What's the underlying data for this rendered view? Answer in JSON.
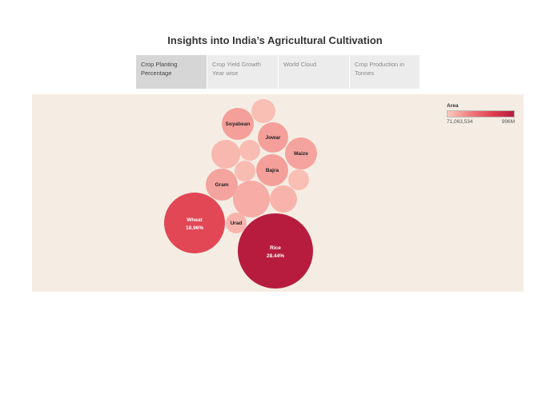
{
  "page": {
    "title": "Insights into India’s Agricultural Cultivation"
  },
  "tabs": [
    {
      "label": "Crop Planting\nPercentage",
      "active": true
    },
    {
      "label": "Crop Yield Growth\nYear wise",
      "active": false
    },
    {
      "label": "World Cloud",
      "active": false
    },
    {
      "label": "Crop Production in\nTonnes",
      "active": false
    }
  ],
  "legend": {
    "title": "Area",
    "min_label": "71,063,534",
    "max_label": "996M"
  },
  "bubbles": [
    {
      "name": "Rice",
      "pct": "28.44%",
      "label": "Rice",
      "pct_label": "28.44%",
      "level": 1.0
    },
    {
      "name": "Wheat",
      "pct": "18.96%",
      "label": "Wheat",
      "pct_label": "18.96%",
      "level": 0.66
    },
    {
      "name": "Soyabean",
      "label": "Soyabean",
      "level": 0.2
    },
    {
      "name": "Jowar",
      "label": "Jowar",
      "level": 0.2
    },
    {
      "name": "Maize",
      "label": "Maize",
      "level": 0.18
    },
    {
      "name": "Bajra",
      "label": "Bajra",
      "level": 0.2
    },
    {
      "name": "Gram",
      "label": "Gram",
      "level": 0.18
    },
    {
      "name": "Urad",
      "label": "Urad",
      "level": 0.1
    },
    {
      "name": "unlabeled-1",
      "label": "",
      "level": 0.05
    },
    {
      "name": "unlabeled-2",
      "label": "",
      "level": 0.08
    },
    {
      "name": "unlabeled-3",
      "label": "",
      "level": 0.06
    },
    {
      "name": "unlabeled-4",
      "label": "",
      "level": 0.06
    },
    {
      "name": "unlabeled-5",
      "label": "",
      "level": 0.05
    },
    {
      "name": "unlabeled-6",
      "label": "",
      "level": 0.14
    },
    {
      "name": "unlabeled-7",
      "label": "",
      "level": 0.1
    },
    {
      "name": "unlabeled-8",
      "label": "",
      "level": 0.05
    }
  ],
  "colors": {
    "low": "#fbc9bd",
    "mid": "#f08080",
    "high": "#e0404f",
    "max": "#b71c3f",
    "background": "#f5ede3"
  }
}
